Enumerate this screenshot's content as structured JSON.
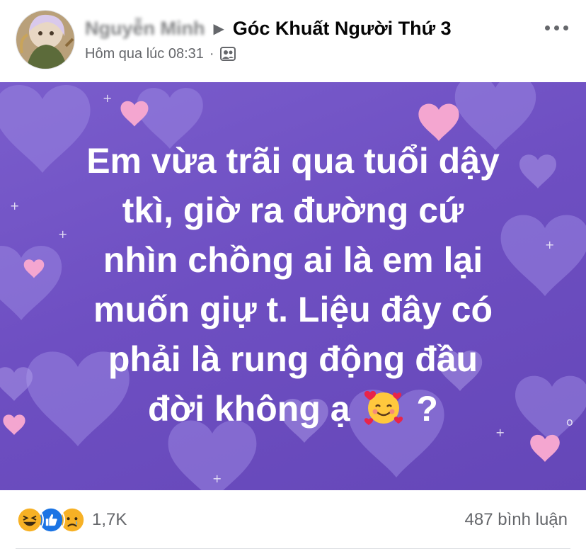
{
  "header": {
    "author_name": "Nguyễn Minh",
    "group_name": "Góc Khuất Người Thứ 3",
    "timestamp": "Hôm qua lúc 08:31",
    "separator": "·",
    "audience_icon": "group-audience-icon",
    "more_icon": "more-options-icon"
  },
  "post": {
    "background_color": "#6e4fc2",
    "text_color": "#ffffff",
    "lines": [
      "Em vừa trãi qua tuổi dậy",
      "tkì, giờ ra đường cứ",
      "nhìn chồng ai là em lại",
      "muốn giự t. Liệu đây có",
      "phải là rung động đầu",
      "đời không ạ"
    ],
    "trailing_emoji": "smiling-face-with-hearts-emoji",
    "trailing_mark": "?"
  },
  "reactions": {
    "icons": [
      "haha-reaction-icon",
      "like-reaction-icon",
      "sad-reaction-icon"
    ],
    "count": "1,7K",
    "comments": "487 bình luận"
  }
}
